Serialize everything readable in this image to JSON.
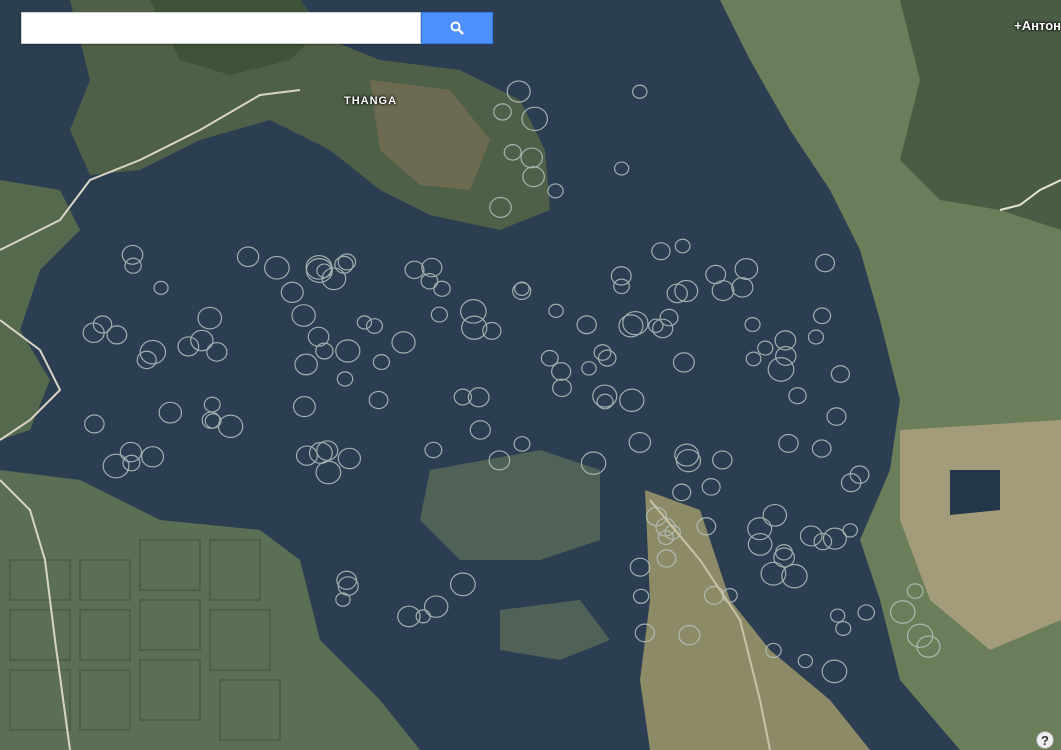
{
  "search": {
    "placeholder": "",
    "value": "",
    "button_icon": "search-icon"
  },
  "header": {
    "user_link": "+Антон"
  },
  "map": {
    "type": "satellite",
    "labels": [
      {
        "text": "THANGA"
      }
    ]
  },
  "help": {
    "label": "?"
  },
  "colors": {
    "water": "#2a3d52",
    "land_green": "#5f7a52",
    "land_tan": "#9a8f6d",
    "search_button": "#4d90fe"
  }
}
